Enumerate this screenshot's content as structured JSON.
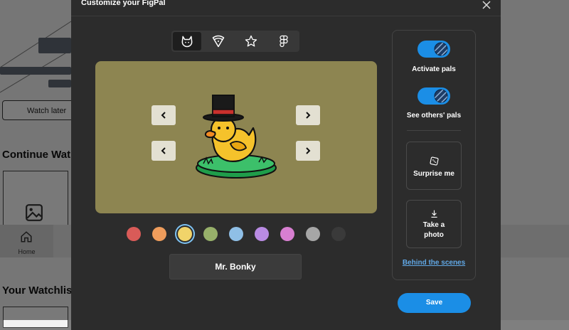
{
  "background": {
    "watch_later_label": "Watch later",
    "continue_heading": "Continue Wat",
    "watchlist_heading": "Your Watchlis",
    "nav_home_label": "Home"
  },
  "modal": {
    "title": "Customize your FigPal",
    "tabs": [
      {
        "name": "character",
        "icon": "cat-face-icon",
        "active": true
      },
      {
        "name": "accessories",
        "icon": "pizza-slice-icon",
        "active": false
      },
      {
        "name": "favorites",
        "icon": "star-icon",
        "active": false
      },
      {
        "name": "figma",
        "icon": "figma-logo-icon",
        "active": false
      }
    ],
    "colors": [
      {
        "name": "red",
        "hex": "#d95b58"
      },
      {
        "name": "orange",
        "hex": "#ef9d5c"
      },
      {
        "name": "yellow",
        "hex": "#f1d46a",
        "selected": true
      },
      {
        "name": "green",
        "hex": "#97b06a"
      },
      {
        "name": "blue",
        "hex": "#8fbfe6"
      },
      {
        "name": "purple",
        "hex": "#b98be3"
      },
      {
        "name": "pink",
        "hex": "#d87fd1"
      },
      {
        "name": "gray",
        "hex": "#a6a6a6"
      },
      {
        "name": "charcoal",
        "hex": "#3a3a3a"
      }
    ],
    "pal_name": "Mr. Bonky",
    "side": {
      "activate_label": "Activate pals",
      "activate_on": true,
      "see_others_label": "See others' pals",
      "see_others_on": true,
      "surprise_label": "Surprise me",
      "photo_label_line1": "Take a",
      "photo_label_line2": "photo",
      "behind_label": "Behind the scenes"
    },
    "save_label": "Save"
  },
  "colors": {
    "accent": "#1b8ee6",
    "stage_bg": "#8d8551",
    "modal_bg": "#2c2c2c"
  }
}
